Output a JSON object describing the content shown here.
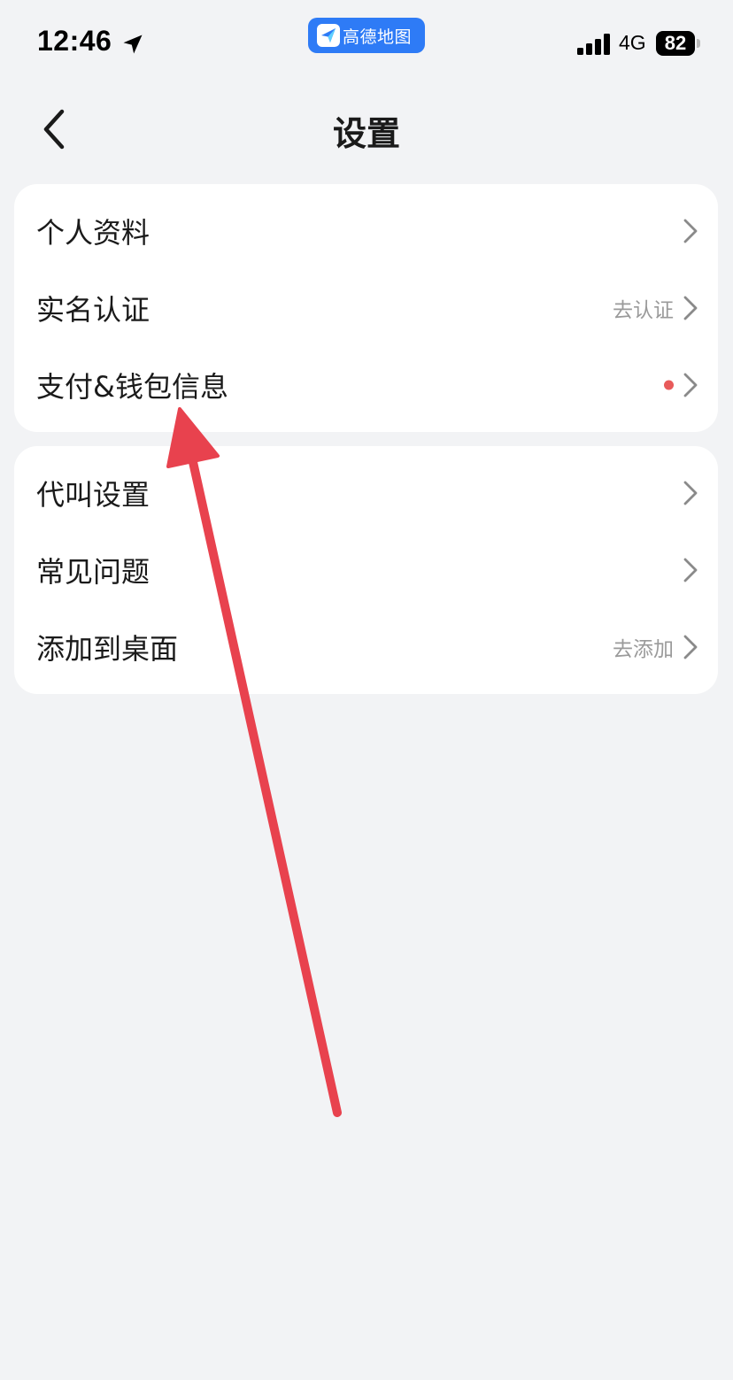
{
  "status_bar": {
    "time": "12:46",
    "app_name": "高德地图",
    "network": "4G",
    "battery": "82"
  },
  "nav": {
    "title": "设置"
  },
  "groups": [
    {
      "items": [
        {
          "label": "个人资料",
          "hint": "",
          "badge": false
        },
        {
          "label": "实名认证",
          "hint": "去认证",
          "badge": false
        },
        {
          "label": "支付&钱包信息",
          "hint": "",
          "badge": true
        }
      ]
    },
    {
      "items": [
        {
          "label": "代叫设置",
          "hint": "",
          "badge": false
        },
        {
          "label": "常见问题",
          "hint": "",
          "badge": false
        },
        {
          "label": "添加到桌面",
          "hint": "去添加",
          "badge": false
        }
      ]
    }
  ],
  "colors": {
    "background": "#f2f3f5",
    "card": "#ffffff",
    "app_pill": "#2e7bf6",
    "badge_dot": "#e85a5a",
    "annotation_arrow": "#e8424e",
    "hint_text": "#9a9a9a"
  }
}
